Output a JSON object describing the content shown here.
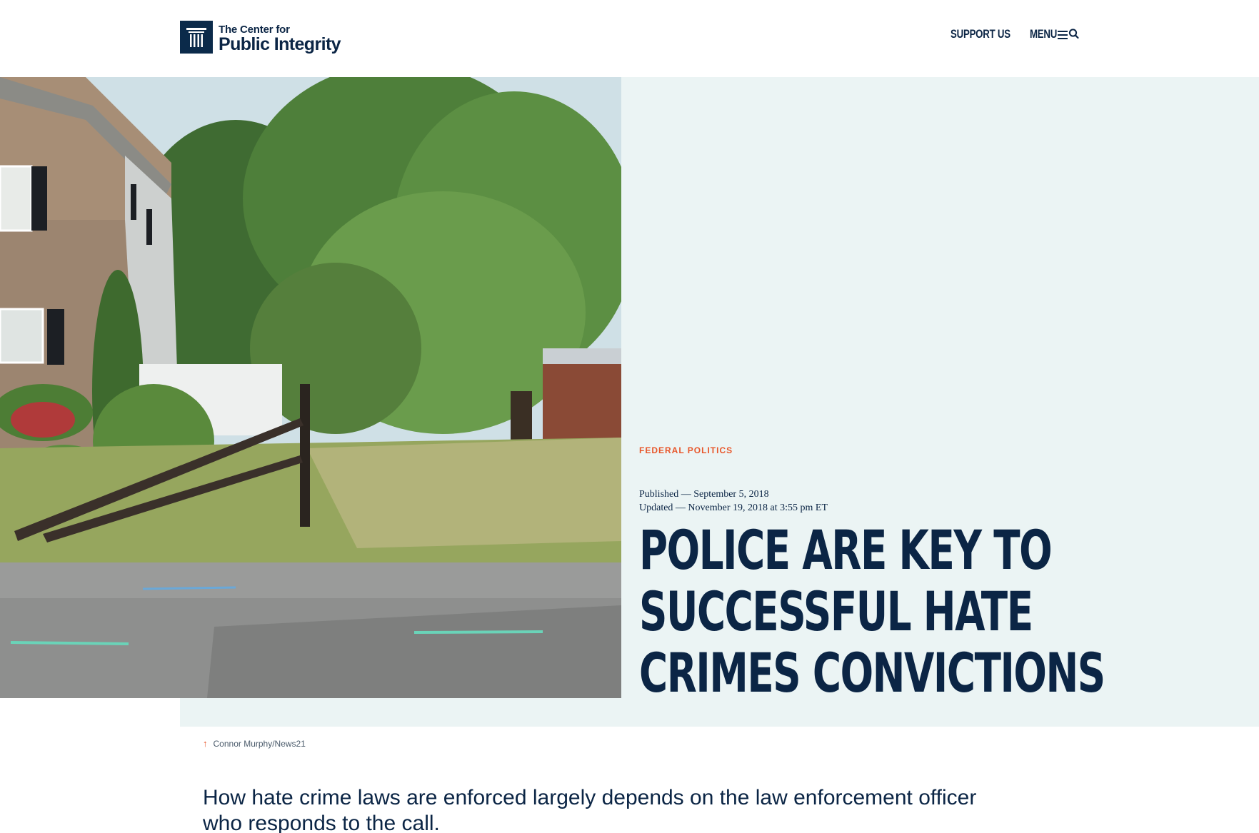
{
  "header": {
    "logo_line1": "The Center for",
    "logo_line2": "Public Integrity",
    "nav": {
      "support": "SUPPORT US",
      "menu": "MENU"
    }
  },
  "article": {
    "category": "FEDERAL POLITICS",
    "published": "Published — September 5, 2018",
    "updated": "Updated — November 19, 2018 at 3:55 pm ET",
    "headline_lines": [
      "POLICE ARE KEY TO",
      "SUCCESSFUL HATE",
      "CRIMES CONVICTIONS"
    ],
    "photo_credit": "Connor Murphy/News21",
    "dek": "How hate crime laws are enforced largely depends on the law enforcement officer who responds to the call."
  },
  "colors": {
    "navy": "#0b2545",
    "accent": "#e8562a",
    "hero_bg": "#ebf4f4"
  },
  "icons": {
    "menu": "hamburger-icon",
    "search": "search-icon",
    "caption": "arrow-up-icon"
  }
}
